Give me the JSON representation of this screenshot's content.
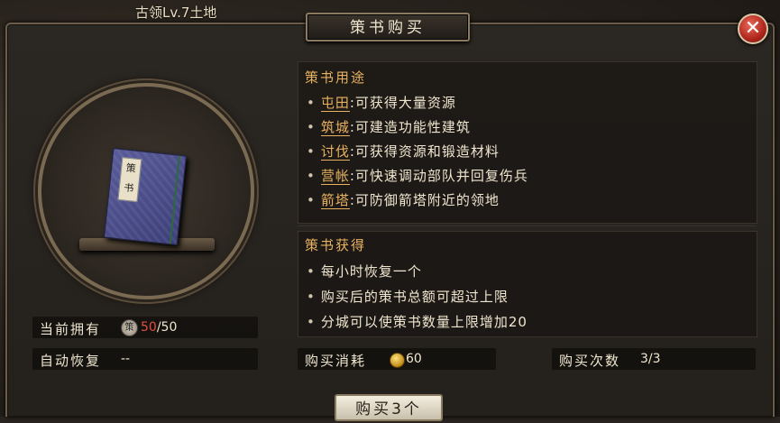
{
  "background": {
    "title": "古领Lv.7土地"
  },
  "dialog": {
    "title": "策书购买",
    "close_glyph": "✕"
  },
  "item": {
    "book_label": "策书"
  },
  "usage": {
    "title": "策书用途",
    "items": [
      {
        "keyword": "屯田",
        "text": ":可获得大量资源"
      },
      {
        "keyword": "筑城",
        "text": ":可建造功能性建筑"
      },
      {
        "keyword": "讨伐",
        "text": ":可获得资源和锻造材料"
      },
      {
        "keyword": "营帐",
        "text": ":可快速调动部队并回复伤兵"
      },
      {
        "keyword": "箭塔",
        "text": ":可防御箭塔附近的领地"
      }
    ]
  },
  "obtain": {
    "title": "策书获得",
    "items": [
      "每小时恢复一个",
      "购买后的策书总额可超过上限",
      "分城可以使策书数量上限增加20"
    ]
  },
  "stats": {
    "owned_label": "当前拥有",
    "owned_icon_glyph": "策",
    "owned_current": "50",
    "owned_max": "/50",
    "recover_label": "自动恢复",
    "recover_value": "--",
    "cost_label": "购买消耗",
    "cost_value": "60",
    "times_label": "购买次数",
    "times_value": "3/3"
  },
  "buy_button": {
    "label": "购买3个"
  },
  "colors": {
    "accent": "#e8b260",
    "text": "#efe6cf",
    "close": "#b0261c"
  }
}
